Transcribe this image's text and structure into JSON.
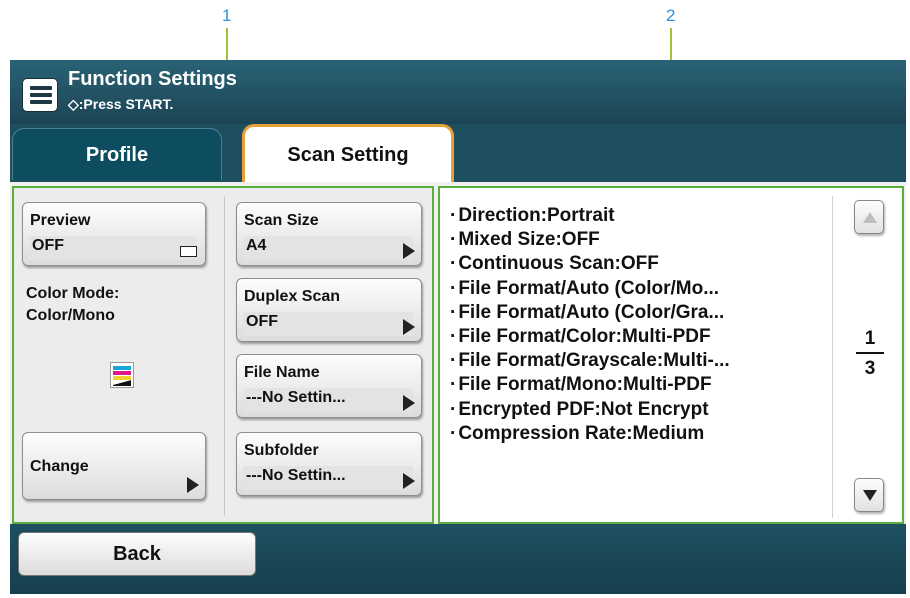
{
  "callouts": [
    "1",
    "2"
  ],
  "header": {
    "title": "Function Settings",
    "subtitle": "◇:Press START."
  },
  "tabs": [
    {
      "label": "Profile",
      "selected": false
    },
    {
      "label": "Scan Setting",
      "selected": true
    }
  ],
  "left_panel": {
    "preview": {
      "label": "Preview",
      "value": "OFF"
    },
    "color_mode_label": "Color Mode:",
    "color_mode_value": "Color/Mono",
    "change_label": "Change",
    "scan_size": {
      "label": "Scan Size",
      "value": "A4"
    },
    "duplex_scan": {
      "label": "Duplex Scan",
      "value": "OFF"
    },
    "file_name": {
      "label": "File Name",
      "value": "---No Settin..."
    },
    "subfolder": {
      "label": "Subfolder",
      "value": "---No Settin..."
    }
  },
  "settings_list": [
    "Direction:Portrait",
    "Mixed Size:OFF",
    "Continuous Scan:OFF",
    "File Format/Auto (Color/Mo...",
    "File Format/Auto (Color/Gra...",
    "File Format/Color:Multi-PDF",
    "File Format/Grayscale:Multi-...",
    "File Format/Mono:Multi-PDF",
    "Encrypted PDF:Not Encrypt",
    "Compression Rate:Medium"
  ],
  "pagination": {
    "current": "1",
    "total": "3"
  },
  "footer": {
    "back_label": "Back"
  },
  "colors": {
    "accent_tab": "#e7a13a",
    "highlight_border": "#5aae3b",
    "header_bg": "#1e4f5f",
    "callout_text": "#2f8fd6"
  }
}
